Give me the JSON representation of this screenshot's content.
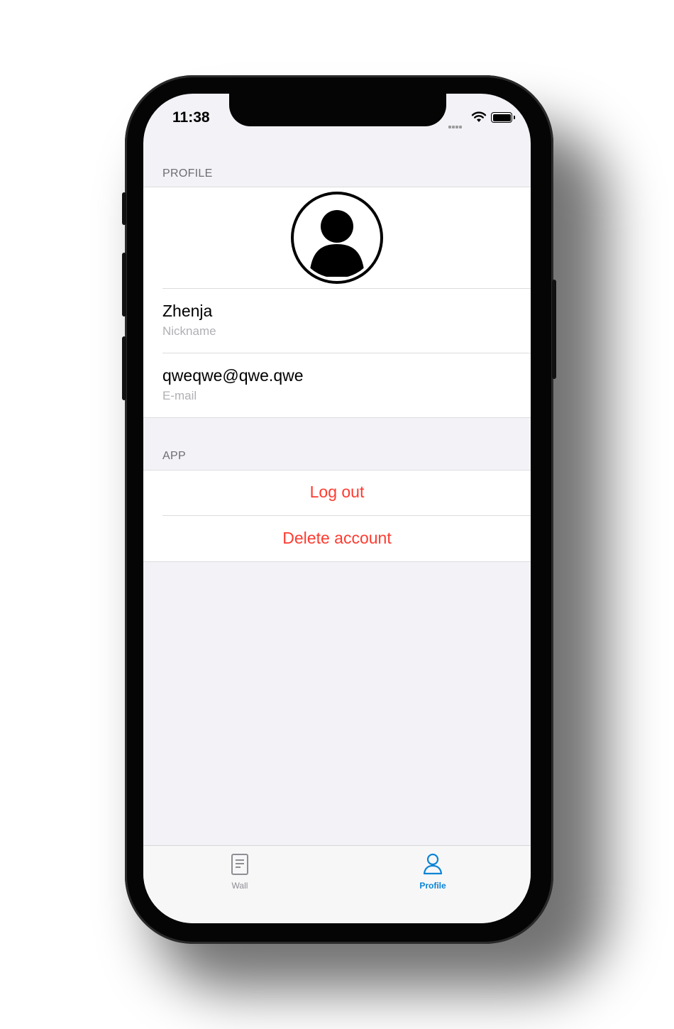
{
  "status_bar": {
    "time": "11:38"
  },
  "profile_section": {
    "header": "PROFILE",
    "avatar_icon": "user-avatar-icon",
    "name": {
      "value": "Zhenja",
      "label": "Nickname"
    },
    "email": {
      "value": "qweqwe@qwe.qwe",
      "label": "E-mail"
    }
  },
  "app_section": {
    "header": "APP",
    "logout_label": "Log out",
    "delete_label": "Delete account",
    "action_color": "#ff3b30"
  },
  "tab_bar": {
    "tabs": [
      {
        "label": "Wall",
        "icon": "document-icon",
        "active": false
      },
      {
        "label": "Profile",
        "icon": "person-icon",
        "active": true
      }
    ],
    "active_color": "#0a84d6",
    "inactive_color": "#8e8e93"
  }
}
